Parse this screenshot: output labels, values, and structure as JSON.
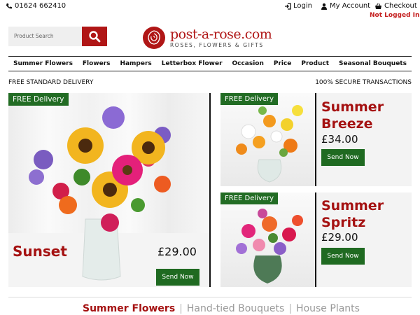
{
  "topbar": {
    "phone": "01624 662410",
    "login": "Login",
    "my_account": "My Account",
    "checkout": "Checkout",
    "status": "Not Logged In"
  },
  "search": {
    "placeholder": "Product Search"
  },
  "logo": {
    "title": "post-a-rose.com",
    "subtitle": "ROSES, FLOWERS & GIFTS"
  },
  "nav": [
    "Summer Flowers",
    "Flowers",
    "Hampers",
    "Letterbox Flower",
    "Occasion",
    "Price",
    "Product",
    "Seasonal Bouquets"
  ],
  "strip": {
    "left": "FREE STANDARD DELIVERY",
    "right": "100% SECURE TRANSACTIONS"
  },
  "products": [
    {
      "badge": "FREE Delivery",
      "name": "Sunset",
      "price": "£29.00",
      "button": "Send Now"
    },
    {
      "badge": "FREE Delivery",
      "name": "Summer Breeze",
      "price": "£34.00",
      "button": "Send Now"
    },
    {
      "badge": "FREE Delivery",
      "name": "Summer Spritz",
      "price": "£29.00",
      "button": "Send Now"
    }
  ],
  "tabs": [
    "Summer Flowers",
    "Hand-tied Bouquets",
    "House Plants"
  ],
  "colors": {
    "brand_red": "#b01616",
    "green": "#1f6a21"
  },
  "icons": {
    "phone": "phone-icon",
    "login": "login-icon",
    "account": "user-icon",
    "checkout": "basket-icon",
    "search": "search-icon"
  }
}
